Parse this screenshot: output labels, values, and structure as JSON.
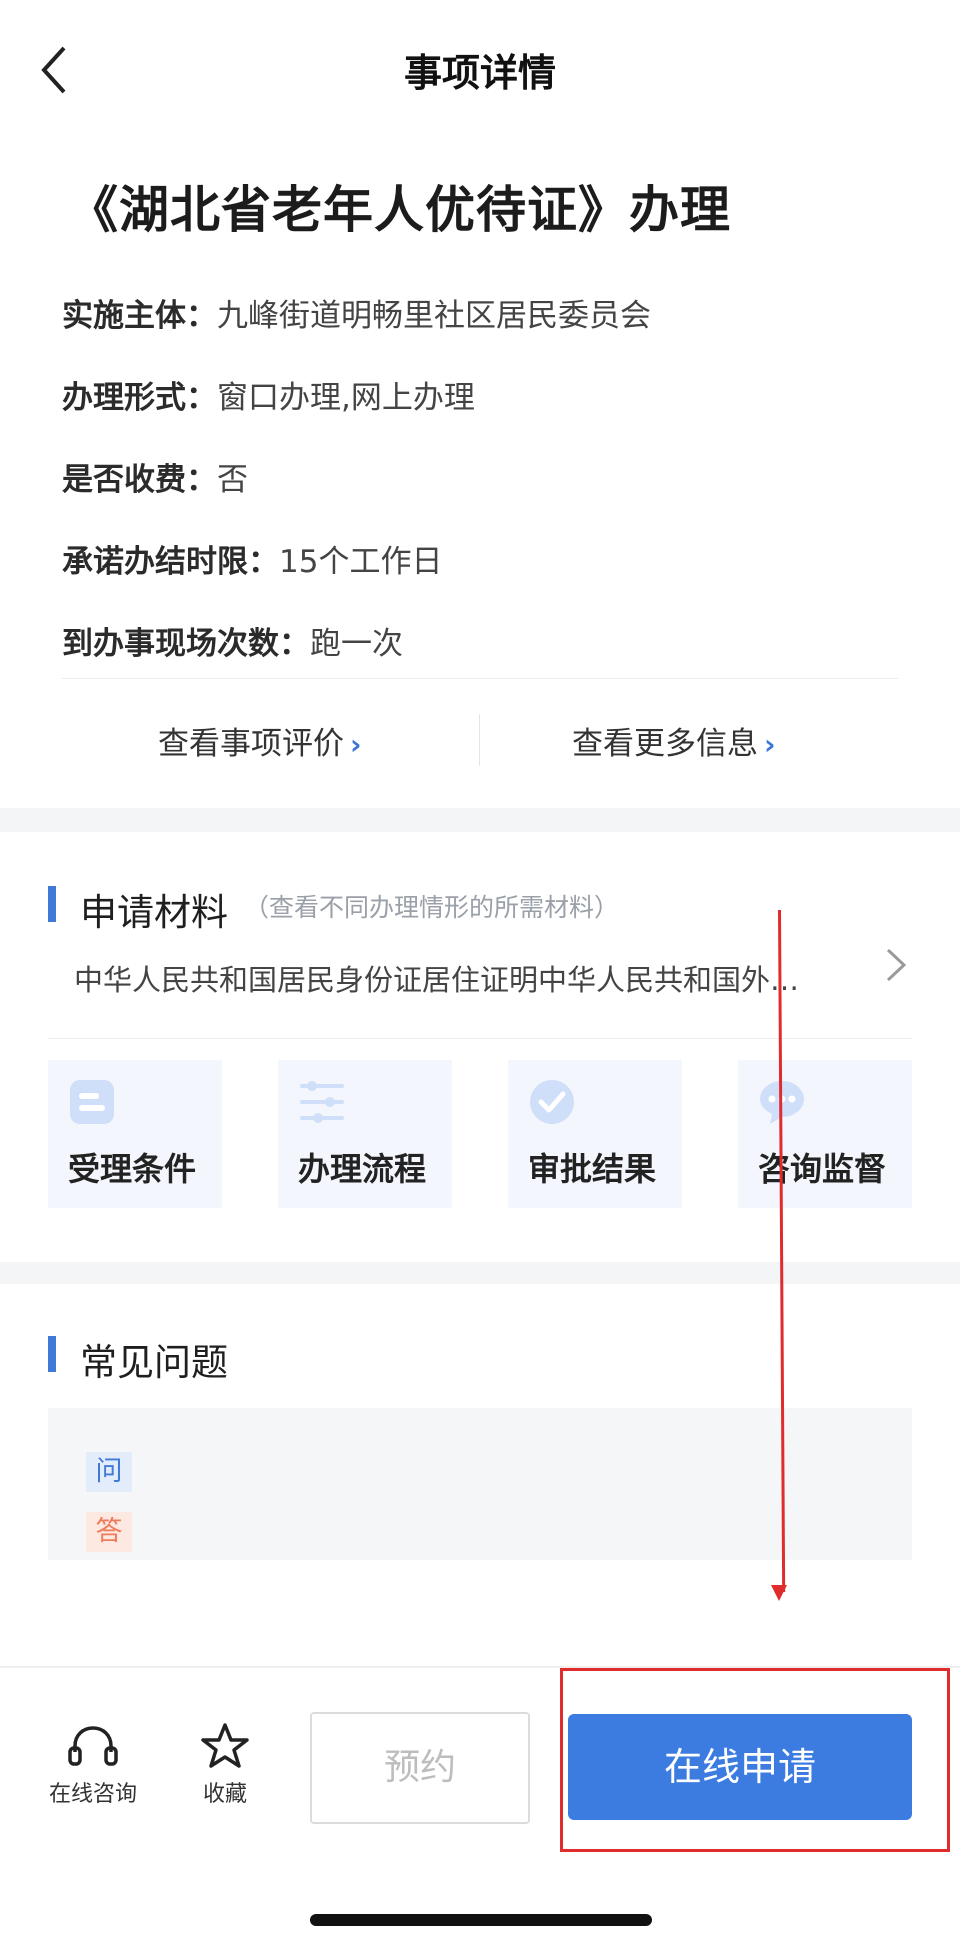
{
  "header": {
    "title": "事项详情"
  },
  "item": {
    "title": "《湖北省老年人优待证》办理",
    "fields": [
      {
        "key": "实施主体：",
        "value": "九峰街道明畅里社区居民委员会"
      },
      {
        "key": "办理形式：",
        "value": "窗口办理,网上办理"
      },
      {
        "key": "是否收费：",
        "value": "否"
      },
      {
        "key": "承诺办结时限：",
        "value": "15个工作日"
      },
      {
        "key": "到办事现场次数：",
        "value": "跑一次"
      }
    ],
    "links": {
      "evaluate": "查看事项评价",
      "more": "查看更多信息"
    }
  },
  "materials": {
    "title": "申请材料",
    "subtitle": "（查看不同办理情形的所需材料）",
    "text": "中华人民共和国居民身份证居住证明中华人民共和国外…",
    "cards": [
      {
        "label": "受理条件",
        "icon": "conditions-icon"
      },
      {
        "label": "办理流程",
        "icon": "process-icon"
      },
      {
        "label": "审批结果",
        "icon": "result-check-icon"
      },
      {
        "label": "咨询监督",
        "icon": "chat-bubble-icon"
      }
    ]
  },
  "faq": {
    "title": "常见问题",
    "q_tag": "问",
    "a_tag": "答"
  },
  "bottom_bar": {
    "consult": "在线咨询",
    "favorite": "收藏",
    "reserve": "预约",
    "apply": "在线申请"
  },
  "colors": {
    "accent": "#3c7ce0",
    "annotation": "#e02c2c",
    "section_bar": "#3f7ad8"
  }
}
